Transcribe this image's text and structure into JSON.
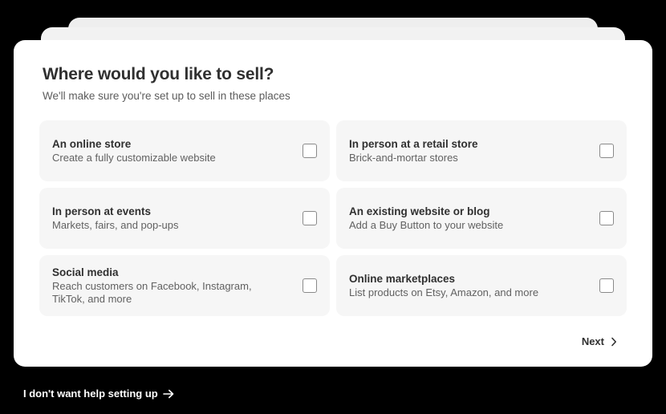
{
  "header": {
    "title": "Where would you like to sell?",
    "subtitle": "We'll make sure you're set up to sell in these places"
  },
  "options": [
    {
      "title": "An online store",
      "description": "Create a fully customizable website",
      "checked": false
    },
    {
      "title": "In person at a retail store",
      "description": "Brick-and-mortar stores",
      "checked": false
    },
    {
      "title": "In person at events",
      "description": "Markets, fairs, and pop-ups",
      "checked": false
    },
    {
      "title": "An existing website or blog",
      "description": "Add a Buy Button to your website",
      "checked": false
    },
    {
      "title": "Social media",
      "description": "Reach customers on Facebook, Instagram, TikTok, and more",
      "checked": false
    },
    {
      "title": "Online marketplaces",
      "description": "List products on Etsy, Amazon, and more",
      "checked": false
    }
  ],
  "footer": {
    "next_label": "Next",
    "next_icon": "chevron-right-icon",
    "skip_label": "I don't want help setting up",
    "skip_icon": "arrow-right-icon"
  },
  "colors": {
    "background": "#000000",
    "card": "#ffffff",
    "option_background": "#f6f6f6",
    "text_primary": "#303030",
    "text_secondary": "#616161"
  }
}
